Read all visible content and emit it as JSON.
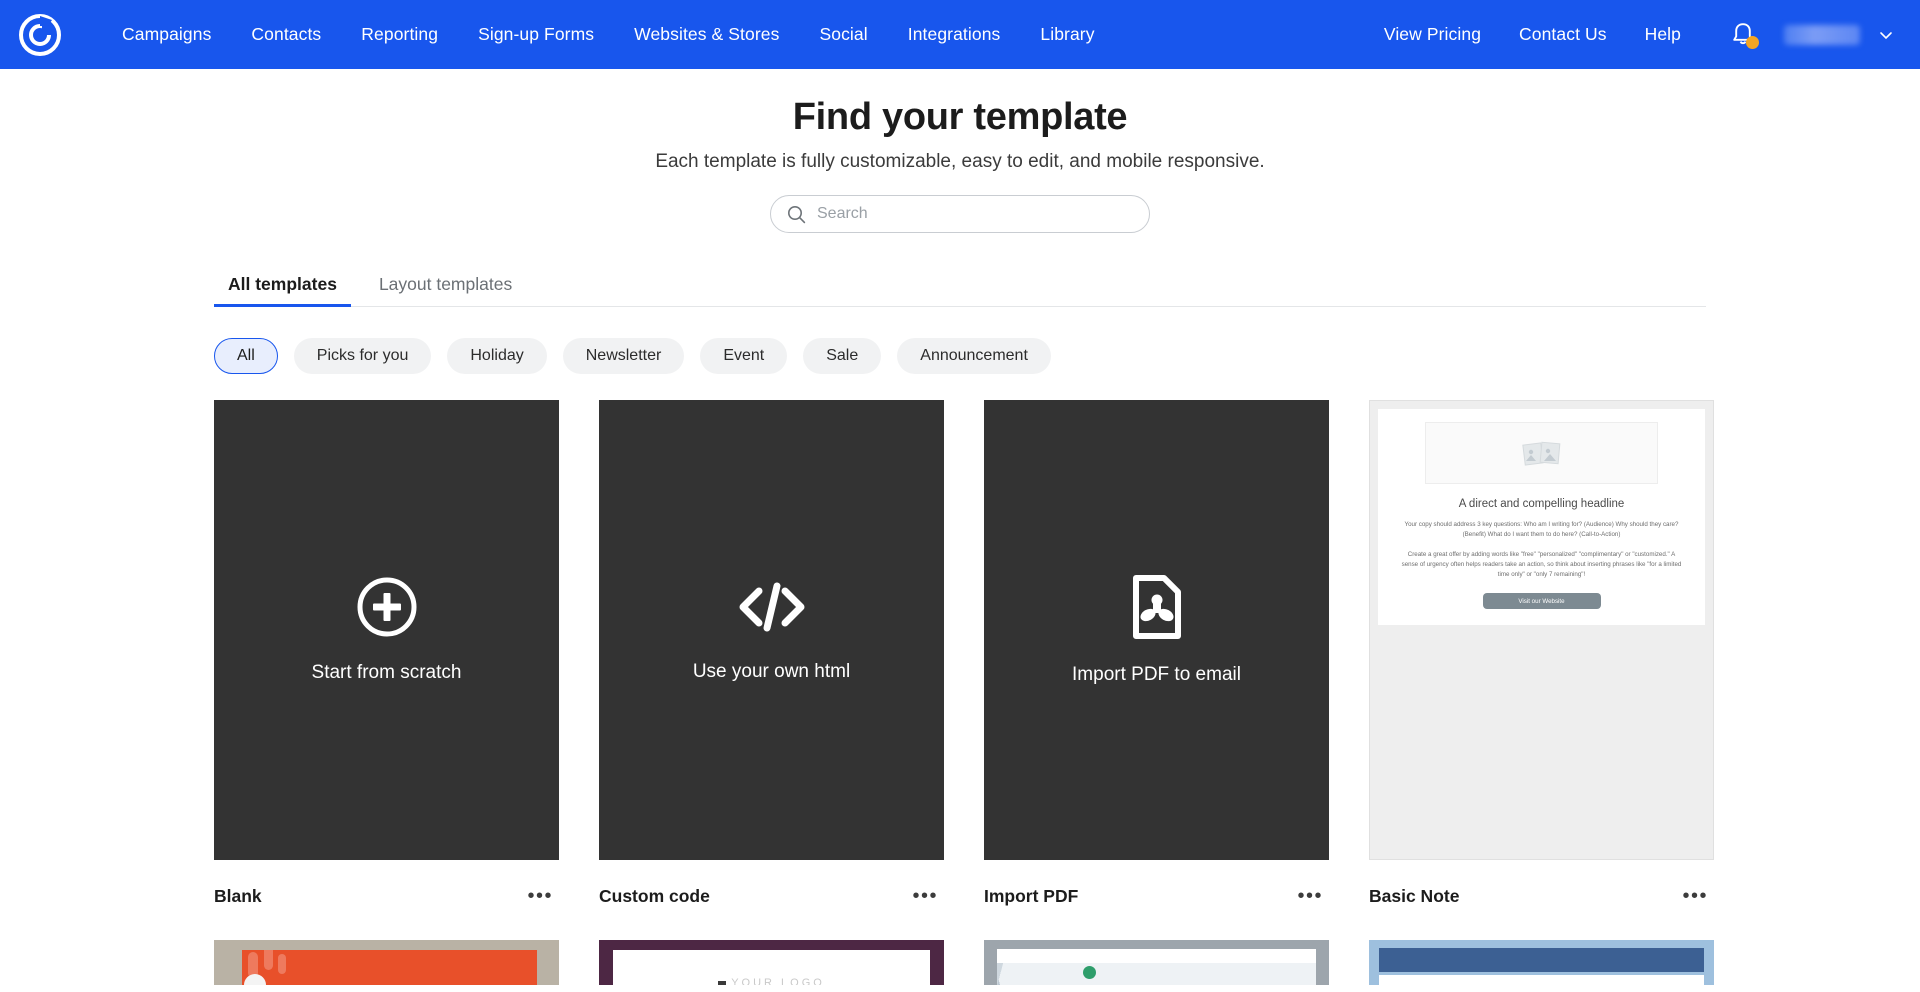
{
  "brand": {
    "color": "#1856ED",
    "logo_icon": "constant-contact-logo-icon"
  },
  "nav": {
    "left_items": [
      {
        "label": "Campaigns"
      },
      {
        "label": "Contacts"
      },
      {
        "label": "Reporting"
      },
      {
        "label": "Sign-up Forms"
      },
      {
        "label": "Websites & Stores"
      },
      {
        "label": "Social"
      },
      {
        "label": "Integrations"
      },
      {
        "label": "Library"
      }
    ],
    "right_items": [
      {
        "label": "View Pricing"
      },
      {
        "label": "Contact Us"
      },
      {
        "label": "Help"
      }
    ],
    "notification_icon": "bell-icon",
    "notification_badge_color": "#F5A623",
    "account_name": "",
    "chevron_icon": "chevron-down-icon"
  },
  "hero": {
    "title": "Find your template",
    "subtitle": "Each template is fully customizable, easy to edit, and mobile responsive."
  },
  "search": {
    "placeholder": "Search",
    "value": "",
    "icon": "search-icon"
  },
  "tabs": [
    {
      "label": "All templates",
      "active": true
    },
    {
      "label": "Layout templates",
      "active": false
    }
  ],
  "filter_chips": [
    {
      "label": "All",
      "selected": true
    },
    {
      "label": "Picks for you",
      "selected": false
    },
    {
      "label": "Holiday",
      "selected": false
    },
    {
      "label": "Newsletter",
      "selected": false
    },
    {
      "label": "Event",
      "selected": false
    },
    {
      "label": "Sale",
      "selected": false
    },
    {
      "label": "Announcement",
      "selected": false
    }
  ],
  "cards": [
    {
      "title": "Blank",
      "thumb_label": "Start from scratch",
      "icon": "plus-circle-icon",
      "menu": "•••"
    },
    {
      "title": "Custom code",
      "thumb_label": "Use your own html",
      "icon": "code-brackets-icon",
      "menu": "•••"
    },
    {
      "title": "Import PDF",
      "thumb_label": "Import PDF to email",
      "icon": "pdf-file-icon",
      "menu": "•••"
    },
    {
      "title": "Basic Note",
      "thumb_label": "",
      "icon": "email-preview",
      "menu": "•••"
    }
  ],
  "basic_note_preview": {
    "headline": "A direct and compelling headline",
    "paragraph1": "Your copy should address 3 key questions: Who am I writing for? (Audience) Why should they care? (Benefit) What do I want them to do here? (Call-to-Action)",
    "paragraph2": "Create a great offer by adding words like \"free\" \"personalized\" \"complimentary\" or \"customized.\" A sense of urgency often helps readers take an action, so think about inserting phrases like \"for a limited time only\" or \"only 7 remaining\"!",
    "button_label": "Visit our Website",
    "image_placeholder_icon": "photos-placeholder-icon",
    "button_color": "#7D8A92"
  },
  "next_row_previews": [
    {
      "frame_color": "#B9B2A5",
      "accent_color": "#E8502A"
    },
    {
      "frame_color": "#4D2744",
      "logo_text": "YOUR LOGO"
    },
    {
      "frame_color": "#9DA5AC",
      "accent_color": "#2E9E6B"
    },
    {
      "frame_color": "#9EC0DE",
      "accent_color": "#3C6093"
    }
  ]
}
